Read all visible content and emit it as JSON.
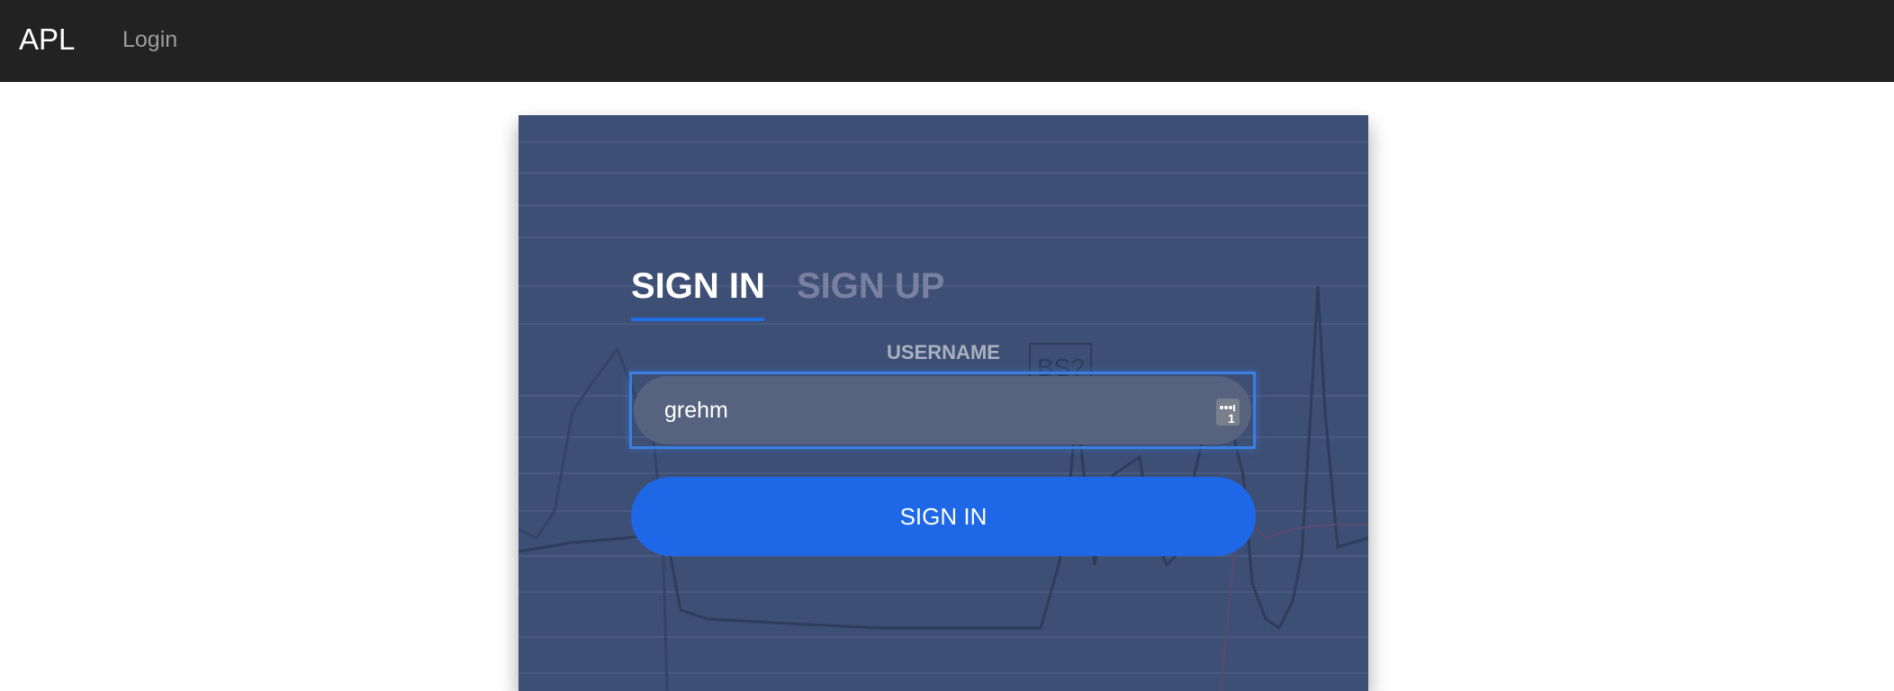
{
  "navbar": {
    "brand": "APL",
    "links": [
      {
        "label": "Login"
      }
    ]
  },
  "auth_card": {
    "tabs": [
      {
        "label": "SIGN IN",
        "active": true
      },
      {
        "label": "SIGN UP",
        "active": false
      }
    ],
    "username_label": "USERNAME",
    "username_value": "grehm",
    "password_manager_badge": "1",
    "submit_label": "SIGN IN",
    "background_chart_label": "BS?"
  },
  "colors": {
    "navbar": "#222222",
    "card": "#3e4f75",
    "accent": "#1e68e8",
    "focus_border": "#3b7fe0"
  }
}
